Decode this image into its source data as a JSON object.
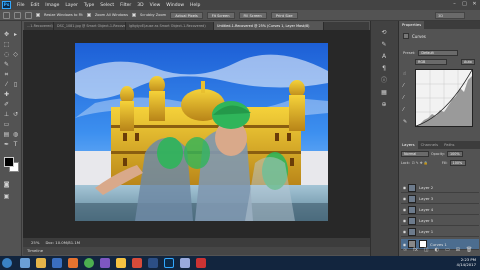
{
  "menu": {
    "logo": "Ps",
    "items": [
      "File",
      "Edit",
      "Image",
      "Layer",
      "Type",
      "Select",
      "Filter",
      "3D",
      "View",
      "Window",
      "Help"
    ],
    "win_min": "–",
    "win_max": "□",
    "win_close": "✕"
  },
  "options": {
    "resize_label": "Resize Windows to Fit",
    "zoom_all_label": "Zoom All Windows",
    "scrubby_label": "Scrubby Zoom",
    "actual_pixels": "Actual Pixels",
    "fit_screen": "Fit Screen",
    "fill_screen": "Fill Screen",
    "print_size": "Print Size",
    "workspace": "3D"
  },
  "tabs": [
    {
      "label": "...1-Recovered)",
      "active": false
    },
    {
      "label": "DSC_1081.jpg @ Smart Object-1-Recovered",
      "active": false
    },
    {
      "label": "lgItgtyvE(ause as Smart Object-1-Recovered)",
      "active": false
    },
    {
      "label": "Untitled-1-Recovered @ 25% (Curves 1, Layer Mask/8)",
      "active": true
    }
  ],
  "status": {
    "zoom": "25%",
    "doc": "Doc: 10.0M/81.1M"
  },
  "timeline_label": "Timeline",
  "properties": {
    "tabs": [
      "Properties"
    ],
    "title": "Curves",
    "preset_label": "Preset:",
    "preset_value": "Default",
    "channel_value": "RGB",
    "auto_label": "Auto"
  },
  "layers_panel": {
    "tabs": [
      "Layers",
      "Channels",
      "Paths"
    ],
    "blend_mode": "Normal",
    "opacity_label": "Opacity:",
    "opacity_value": "100%",
    "lock_label": "Lock:",
    "fill_label": "Fill:",
    "fill_value": "100%",
    "layers": [
      {
        "name": "Layer 2",
        "active": false
      },
      {
        "name": "Layer 3",
        "active": false
      },
      {
        "name": "Layer 4",
        "active": false
      },
      {
        "name": "Layer 5",
        "active": false
      },
      {
        "name": "Layer 1",
        "active": false
      },
      {
        "name": "Curves 1",
        "active": true
      }
    ]
  },
  "taskbar": {
    "time": "2:23 PM",
    "date": "4/14/2017"
  },
  "colors": {
    "accent": "#31a8ff",
    "selection": "#4c6d8f",
    "turban": "#2fb55a"
  }
}
